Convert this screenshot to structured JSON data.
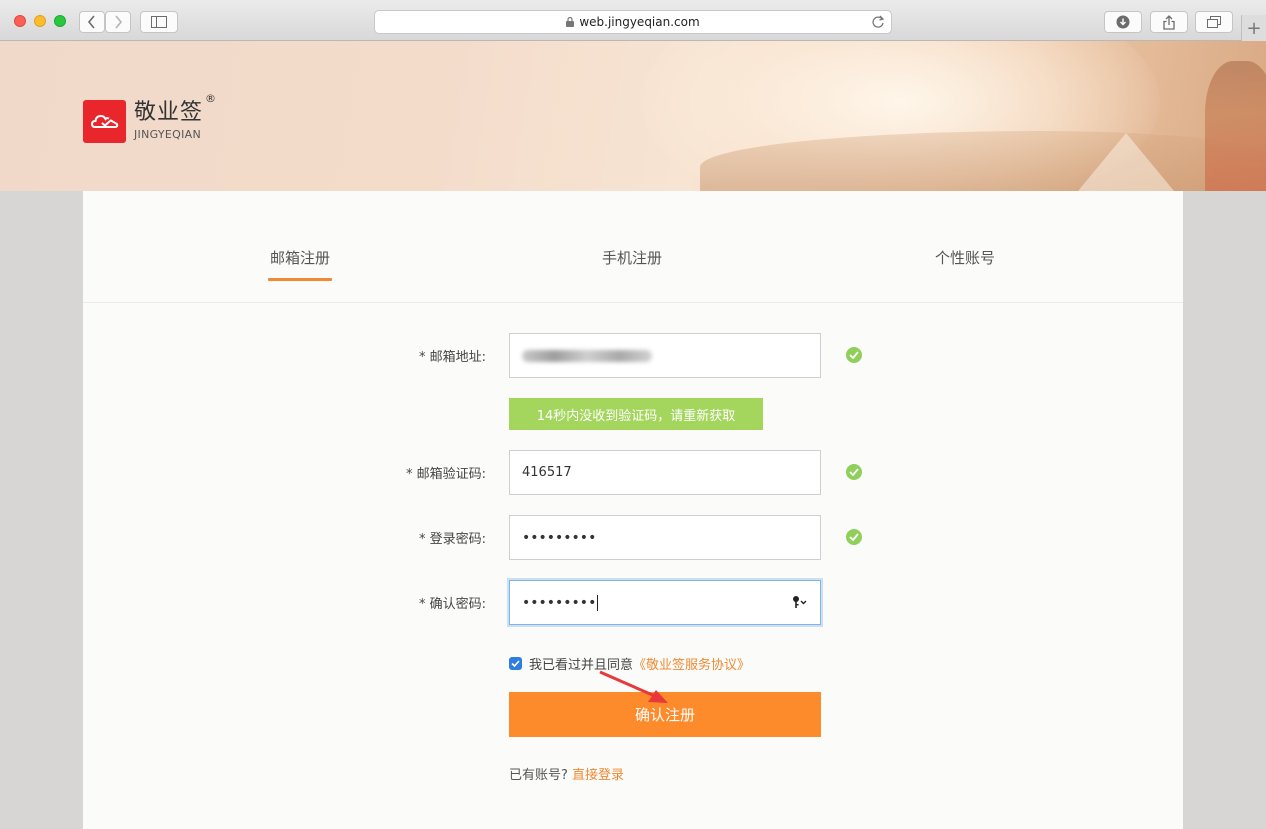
{
  "browser": {
    "url": "web.jingyeqian.com",
    "new_tab": "+"
  },
  "logo": {
    "name_cn": "敬业签",
    "name_en": "JINGYEQIAN",
    "registered": "®"
  },
  "tabs": [
    {
      "label": "邮箱注册",
      "active": true
    },
    {
      "label": "手机注册",
      "active": false
    },
    {
      "label": "个性账号",
      "active": false
    }
  ],
  "form": {
    "email_label": "* 邮箱地址:",
    "code_button": "14秒内没收到验证码，请重新获取",
    "code_label": "* 邮箱验证码:",
    "code_value": "416517",
    "password_label": "* 登录密码:",
    "password_masked": "•••••••••",
    "confirm_label": "* 确认密码:",
    "confirm_masked": "•••••••••",
    "agree_text": "我已看过并且同意",
    "agree_link": "《敬业签服务协议》",
    "agree_checked": true,
    "submit_label": "确认注册",
    "has_account": "已有账号?",
    "login_link": "直接登录"
  },
  "colors": {
    "accent": "#fd8a2b",
    "check_green": "#8fcf5a",
    "code_button": "#a4d65e",
    "logo_red": "#e8262b"
  }
}
